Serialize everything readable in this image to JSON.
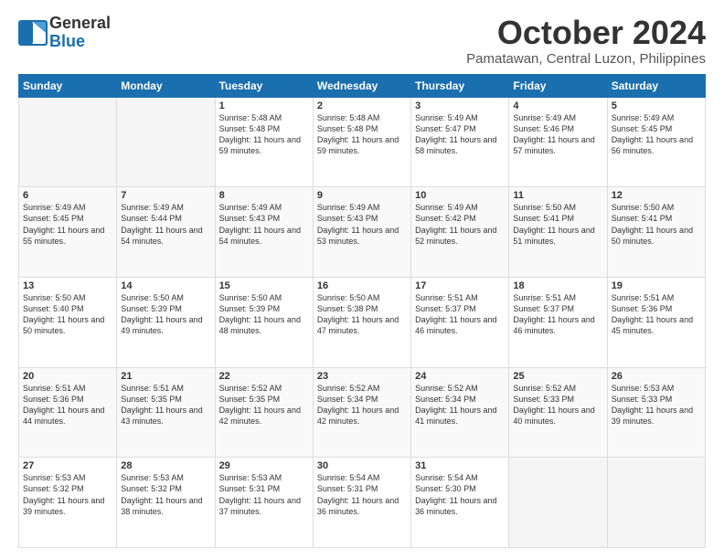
{
  "logo": {
    "line1": "General",
    "line2": "Blue"
  },
  "header": {
    "month": "October 2024",
    "location": "Pamatawan, Central Luzon, Philippines"
  },
  "weekdays": [
    "Sunday",
    "Monday",
    "Tuesday",
    "Wednesday",
    "Thursday",
    "Friday",
    "Saturday"
  ],
  "weeks": [
    [
      {
        "day": "",
        "sunrise": "",
        "sunset": "",
        "daylight": ""
      },
      {
        "day": "",
        "sunrise": "",
        "sunset": "",
        "daylight": ""
      },
      {
        "day": "1",
        "sunrise": "Sunrise: 5:48 AM",
        "sunset": "Sunset: 5:48 PM",
        "daylight": "Daylight: 11 hours and 59 minutes."
      },
      {
        "day": "2",
        "sunrise": "Sunrise: 5:48 AM",
        "sunset": "Sunset: 5:48 PM",
        "daylight": "Daylight: 11 hours and 59 minutes."
      },
      {
        "day": "3",
        "sunrise": "Sunrise: 5:49 AM",
        "sunset": "Sunset: 5:47 PM",
        "daylight": "Daylight: 11 hours and 58 minutes."
      },
      {
        "day": "4",
        "sunrise": "Sunrise: 5:49 AM",
        "sunset": "Sunset: 5:46 PM",
        "daylight": "Daylight: 11 hours and 57 minutes."
      },
      {
        "day": "5",
        "sunrise": "Sunrise: 5:49 AM",
        "sunset": "Sunset: 5:45 PM",
        "daylight": "Daylight: 11 hours and 56 minutes."
      }
    ],
    [
      {
        "day": "6",
        "sunrise": "Sunrise: 5:49 AM",
        "sunset": "Sunset: 5:45 PM",
        "daylight": "Daylight: 11 hours and 55 minutes."
      },
      {
        "day": "7",
        "sunrise": "Sunrise: 5:49 AM",
        "sunset": "Sunset: 5:44 PM",
        "daylight": "Daylight: 11 hours and 54 minutes."
      },
      {
        "day": "8",
        "sunrise": "Sunrise: 5:49 AM",
        "sunset": "Sunset: 5:43 PM",
        "daylight": "Daylight: 11 hours and 54 minutes."
      },
      {
        "day": "9",
        "sunrise": "Sunrise: 5:49 AM",
        "sunset": "Sunset: 5:43 PM",
        "daylight": "Daylight: 11 hours and 53 minutes."
      },
      {
        "day": "10",
        "sunrise": "Sunrise: 5:49 AM",
        "sunset": "Sunset: 5:42 PM",
        "daylight": "Daylight: 11 hours and 52 minutes."
      },
      {
        "day": "11",
        "sunrise": "Sunrise: 5:50 AM",
        "sunset": "Sunset: 5:41 PM",
        "daylight": "Daylight: 11 hours and 51 minutes."
      },
      {
        "day": "12",
        "sunrise": "Sunrise: 5:50 AM",
        "sunset": "Sunset: 5:41 PM",
        "daylight": "Daylight: 11 hours and 50 minutes."
      }
    ],
    [
      {
        "day": "13",
        "sunrise": "Sunrise: 5:50 AM",
        "sunset": "Sunset: 5:40 PM",
        "daylight": "Daylight: 11 hours and 50 minutes."
      },
      {
        "day": "14",
        "sunrise": "Sunrise: 5:50 AM",
        "sunset": "Sunset: 5:39 PM",
        "daylight": "Daylight: 11 hours and 49 minutes."
      },
      {
        "day": "15",
        "sunrise": "Sunrise: 5:50 AM",
        "sunset": "Sunset: 5:39 PM",
        "daylight": "Daylight: 11 hours and 48 minutes."
      },
      {
        "day": "16",
        "sunrise": "Sunrise: 5:50 AM",
        "sunset": "Sunset: 5:38 PM",
        "daylight": "Daylight: 11 hours and 47 minutes."
      },
      {
        "day": "17",
        "sunrise": "Sunrise: 5:51 AM",
        "sunset": "Sunset: 5:37 PM",
        "daylight": "Daylight: 11 hours and 46 minutes."
      },
      {
        "day": "18",
        "sunrise": "Sunrise: 5:51 AM",
        "sunset": "Sunset: 5:37 PM",
        "daylight": "Daylight: 11 hours and 46 minutes."
      },
      {
        "day": "19",
        "sunrise": "Sunrise: 5:51 AM",
        "sunset": "Sunset: 5:36 PM",
        "daylight": "Daylight: 11 hours and 45 minutes."
      }
    ],
    [
      {
        "day": "20",
        "sunrise": "Sunrise: 5:51 AM",
        "sunset": "Sunset: 5:36 PM",
        "daylight": "Daylight: 11 hours and 44 minutes."
      },
      {
        "day": "21",
        "sunrise": "Sunrise: 5:51 AM",
        "sunset": "Sunset: 5:35 PM",
        "daylight": "Daylight: 11 hours and 43 minutes."
      },
      {
        "day": "22",
        "sunrise": "Sunrise: 5:52 AM",
        "sunset": "Sunset: 5:35 PM",
        "daylight": "Daylight: 11 hours and 42 minutes."
      },
      {
        "day": "23",
        "sunrise": "Sunrise: 5:52 AM",
        "sunset": "Sunset: 5:34 PM",
        "daylight": "Daylight: 11 hours and 42 minutes."
      },
      {
        "day": "24",
        "sunrise": "Sunrise: 5:52 AM",
        "sunset": "Sunset: 5:34 PM",
        "daylight": "Daylight: 11 hours and 41 minutes."
      },
      {
        "day": "25",
        "sunrise": "Sunrise: 5:52 AM",
        "sunset": "Sunset: 5:33 PM",
        "daylight": "Daylight: 11 hours and 40 minutes."
      },
      {
        "day": "26",
        "sunrise": "Sunrise: 5:53 AM",
        "sunset": "Sunset: 5:33 PM",
        "daylight": "Daylight: 11 hours and 39 minutes."
      }
    ],
    [
      {
        "day": "27",
        "sunrise": "Sunrise: 5:53 AM",
        "sunset": "Sunset: 5:32 PM",
        "daylight": "Daylight: 11 hours and 39 minutes."
      },
      {
        "day": "28",
        "sunrise": "Sunrise: 5:53 AM",
        "sunset": "Sunset: 5:32 PM",
        "daylight": "Daylight: 11 hours and 38 minutes."
      },
      {
        "day": "29",
        "sunrise": "Sunrise: 5:53 AM",
        "sunset": "Sunset: 5:31 PM",
        "daylight": "Daylight: 11 hours and 37 minutes."
      },
      {
        "day": "30",
        "sunrise": "Sunrise: 5:54 AM",
        "sunset": "Sunset: 5:31 PM",
        "daylight": "Daylight: 11 hours and 36 minutes."
      },
      {
        "day": "31",
        "sunrise": "Sunrise: 5:54 AM",
        "sunset": "Sunset: 5:30 PM",
        "daylight": "Daylight: 11 hours and 36 minutes."
      },
      {
        "day": "",
        "sunrise": "",
        "sunset": "",
        "daylight": ""
      },
      {
        "day": "",
        "sunrise": "",
        "sunset": "",
        "daylight": ""
      }
    ]
  ]
}
